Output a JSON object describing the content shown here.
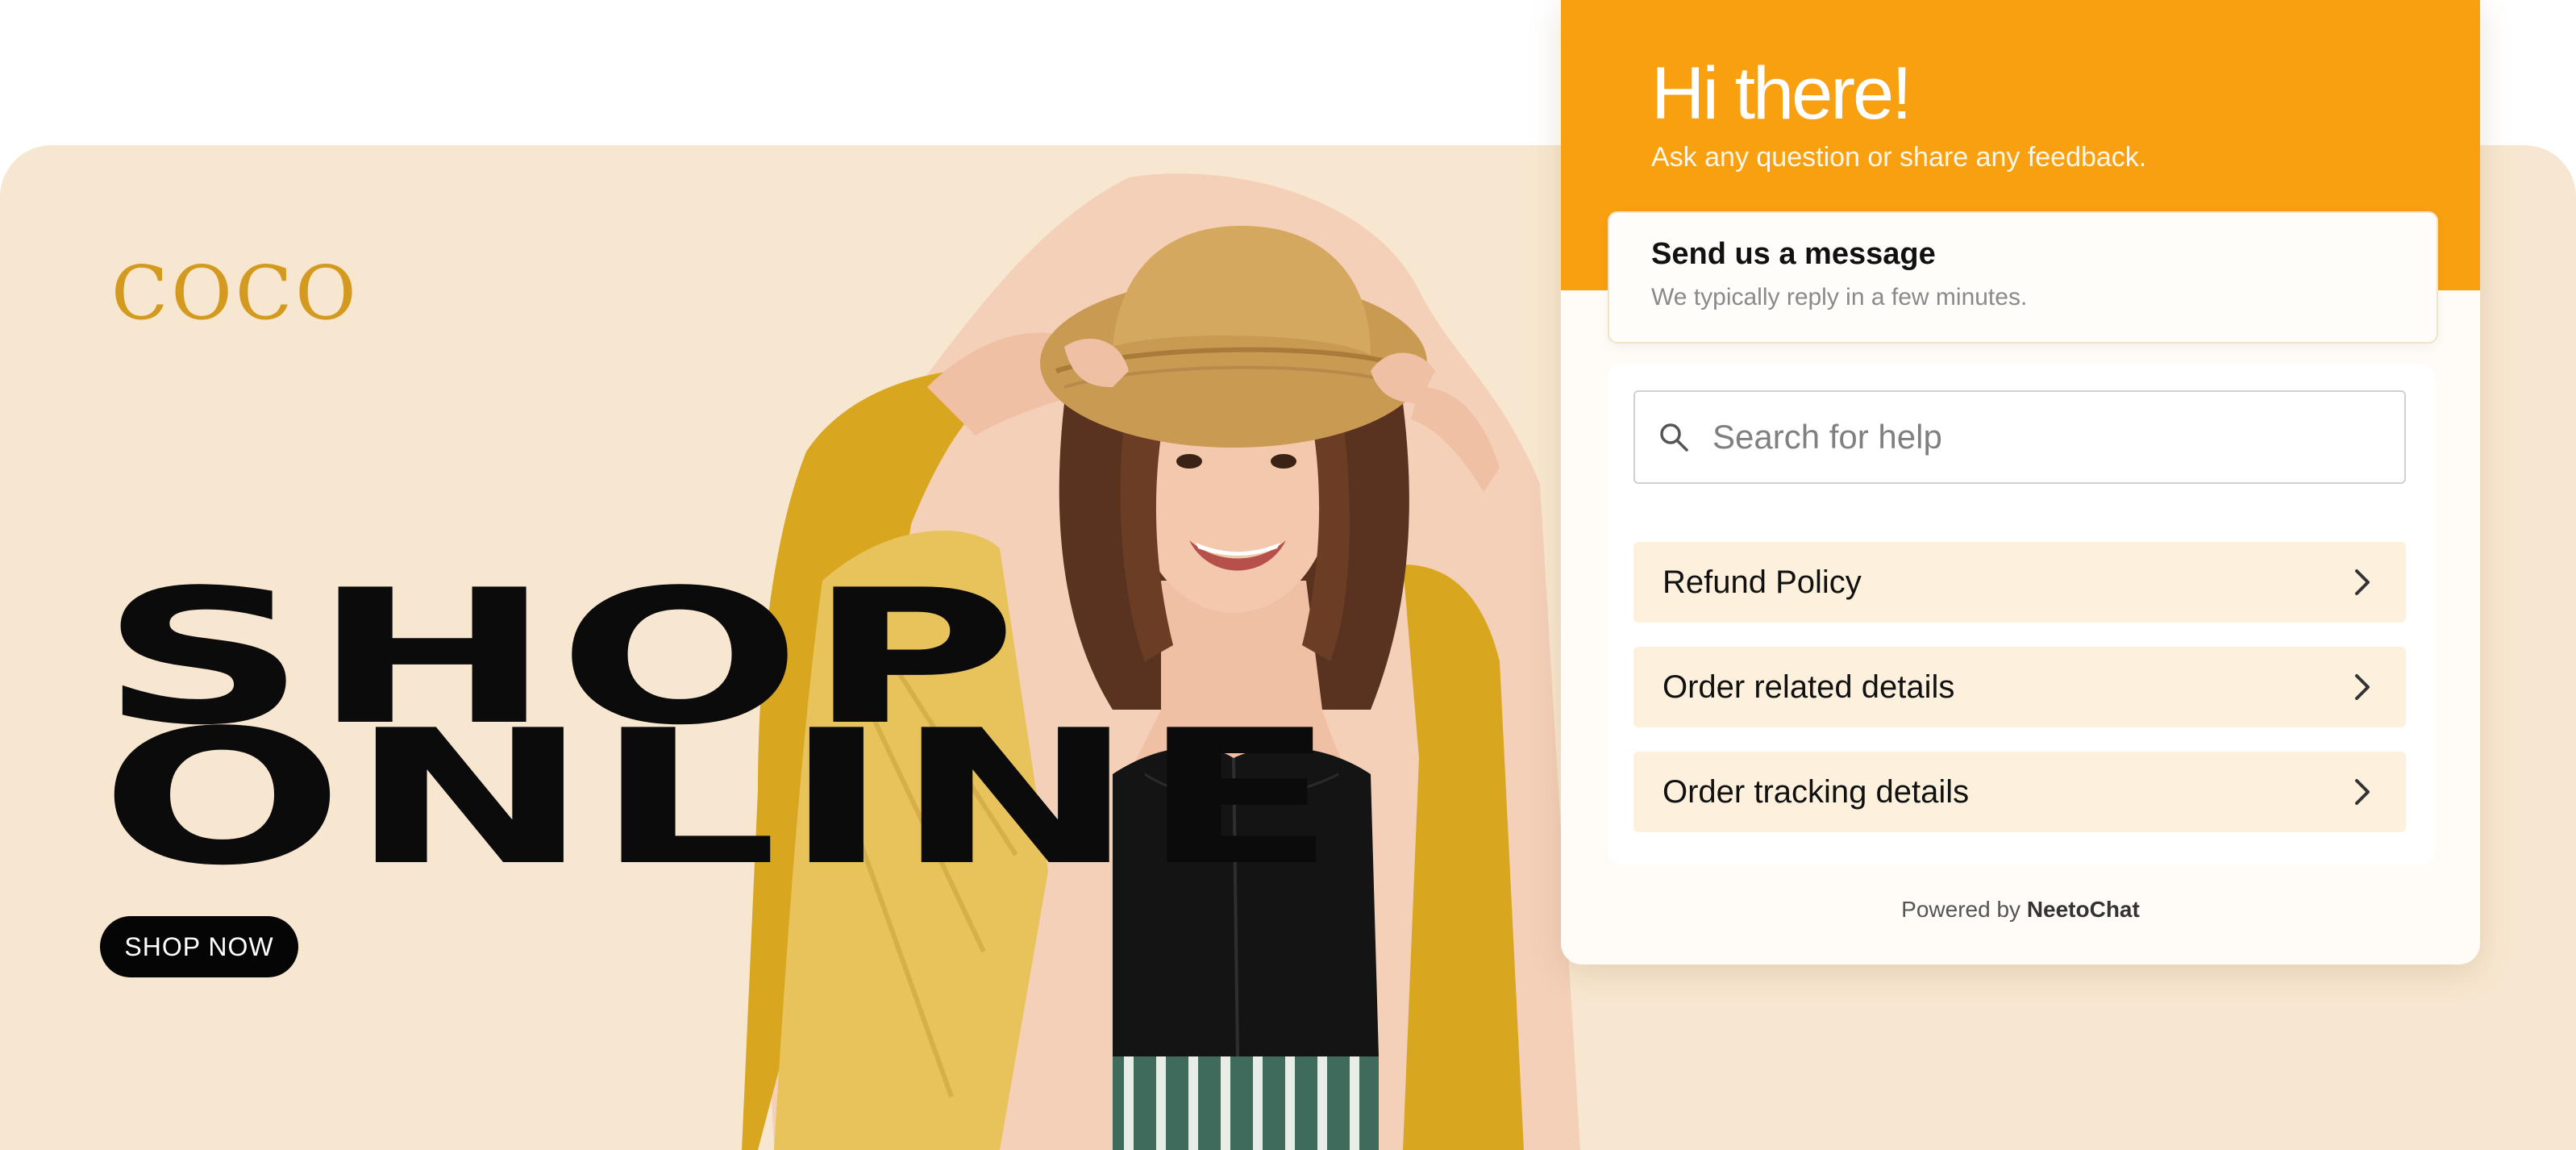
{
  "banner": {
    "logo": "COCO",
    "headline_line1": "SHOP",
    "headline_line2": "ONLINE",
    "cta_label": "SHOP NOW"
  },
  "chat": {
    "greeting_title": "Hi there!",
    "greeting_subtitle": "Ask any question or share any feedback.",
    "message_card": {
      "title": "Send us a message",
      "subtitle": "We typically reply in a few minutes."
    },
    "search": {
      "placeholder": "Search for help",
      "icon": "search-icon"
    },
    "topics": [
      {
        "label": "Refund Policy"
      },
      {
        "label": "Order related details"
      },
      {
        "label": "Order tracking details"
      }
    ],
    "powered_prefix": "Powered by",
    "powered_brand": "NeetoChat"
  },
  "colors": {
    "banner_bg": "#f8e7d0",
    "logo_gold": "#d39a1f",
    "widget_orange": "#f9a011",
    "topic_bg": "#fdf1de",
    "jacket_mustard": "#d9a61f"
  }
}
